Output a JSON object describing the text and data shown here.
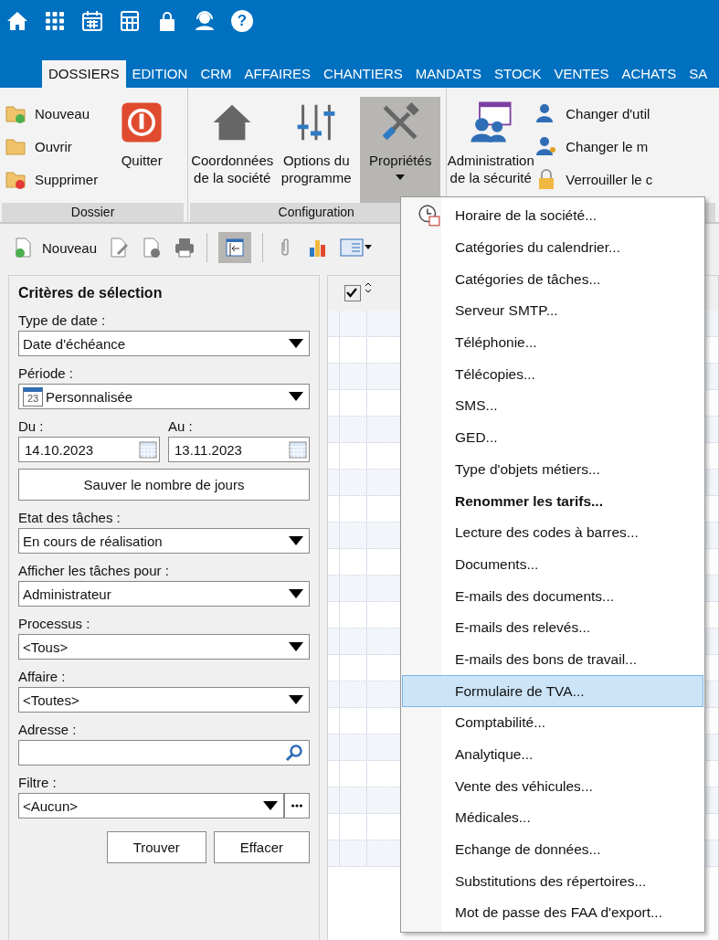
{
  "help_glyph": "?",
  "tabs": [
    {
      "label": "DOSSIERS",
      "selected": true
    },
    {
      "label": "EDITION",
      "selected": false
    },
    {
      "label": "CRM",
      "selected": false
    },
    {
      "label": "AFFAIRES",
      "selected": false
    },
    {
      "label": "CHANTIERS",
      "selected": false
    },
    {
      "label": "MANDATS",
      "selected": false
    },
    {
      "label": "STOCK",
      "selected": false
    },
    {
      "label": "VENTES",
      "selected": false
    },
    {
      "label": "ACHATS",
      "selected": false
    },
    {
      "label": "SA",
      "selected": false
    }
  ],
  "ribbon": {
    "dossier": {
      "label": "Dossier",
      "small": [
        "Nouveau",
        "Ouvrir",
        "Supprimer"
      ],
      "quit": "Quitter"
    },
    "configuration": {
      "label": "Configuration",
      "buttons": [
        {
          "label": "Coordonnées de la société",
          "pressed": false
        },
        {
          "label": "Options du programme",
          "pressed": false
        },
        {
          "label": "Propriétés",
          "pressed": true
        }
      ]
    },
    "security": {
      "big": "Administration de la sécurité",
      "small": [
        "Changer d'util",
        "Changer le m",
        "Verrouiller le c"
      ]
    }
  },
  "toolbar": {
    "new_label": "Nouveau",
    "collapse_pressed": true
  },
  "criteria": {
    "title": "Critères de sélection",
    "date_type": {
      "label": "Type de date :",
      "value": "Date d'échéance"
    },
    "period": {
      "label": "Période :",
      "value": "Personnalisée",
      "icon_day": "23"
    },
    "from": {
      "label": "Du :",
      "value": "14.10.2023"
    },
    "to": {
      "label": "Au :",
      "value": "13.11.2023"
    },
    "save_days": "Sauver le nombre de jours",
    "selects": [
      {
        "label": "Etat des tâches :",
        "value": "En cours de réalisation"
      },
      {
        "label": "Afficher les tâches pour :",
        "value": "Administrateur"
      },
      {
        "label": "Processus :",
        "value": "<Tous>"
      },
      {
        "label": "Affaire :",
        "value": "<Toutes>"
      }
    ],
    "address": {
      "label": "Adresse :"
    },
    "filter": {
      "label": "Filtre :",
      "value": "<Aucun>"
    },
    "buttons": [
      "Trouver",
      "Effacer"
    ]
  },
  "grid": {
    "header_checked": true
  },
  "menu": {
    "items": [
      {
        "label": "Horaire de la société...",
        "bold": false,
        "selected": false
      },
      {
        "label": "Catégories du calendrier...",
        "bold": false,
        "selected": false
      },
      {
        "label": "Catégories de tâches...",
        "bold": false,
        "selected": false
      },
      {
        "label": "Serveur SMTP...",
        "bold": false,
        "selected": false
      },
      {
        "label": "Téléphonie...",
        "bold": false,
        "selected": false
      },
      {
        "label": "Télécopies...",
        "bold": false,
        "selected": false
      },
      {
        "label": "SMS...",
        "bold": false,
        "selected": false
      },
      {
        "label": "GED...",
        "bold": false,
        "selected": false
      },
      {
        "label": "Type d'objets métiers...",
        "bold": false,
        "selected": false
      },
      {
        "label": "Renommer les tarifs...",
        "bold": true,
        "selected": false
      },
      {
        "label": "Lecture des codes à barres...",
        "bold": false,
        "selected": false
      },
      {
        "label": "Documents...",
        "bold": false,
        "selected": false
      },
      {
        "label": "E-mails des documents...",
        "bold": false,
        "selected": false
      },
      {
        "label": "E-mails des relevés...",
        "bold": false,
        "selected": false
      },
      {
        "label": "E-mails des bons de travail...",
        "bold": false,
        "selected": false
      },
      {
        "label": "Formulaire de TVA...",
        "bold": false,
        "selected": true
      },
      {
        "label": "Comptabilité...",
        "bold": false,
        "selected": false
      },
      {
        "label": "Analytique...",
        "bold": false,
        "selected": false
      },
      {
        "label": "Vente des véhicules...",
        "bold": false,
        "selected": false
      },
      {
        "label": "Médicales...",
        "bold": false,
        "selected": false
      },
      {
        "label": "Echange de données...",
        "bold": false,
        "selected": false
      },
      {
        "label": "Substitutions des répertoires...",
        "bold": false,
        "selected": false
      },
      {
        "label": "Mot de passe des FAA d'export...",
        "bold": false,
        "selected": false
      }
    ]
  }
}
